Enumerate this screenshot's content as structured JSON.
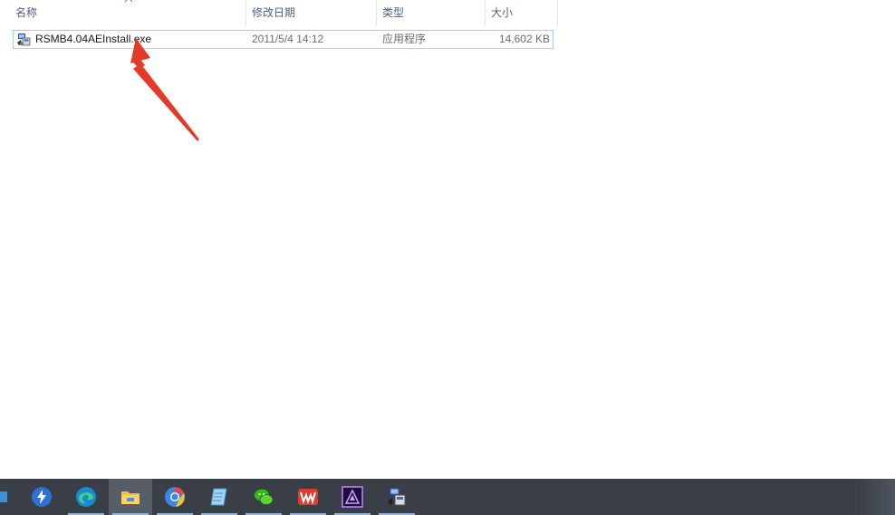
{
  "columns": {
    "name": "名称",
    "date_modified": "修改日期",
    "type": "类型",
    "size": "大小"
  },
  "file": {
    "name": "RSMB4.04AEInstall.exe",
    "date_modified": "2011/5/4 14:12",
    "type": "应用程序",
    "size": "14,602 KB",
    "icon": "installer-icon"
  },
  "colors": {
    "selection_border": "#99d1ff",
    "annotation_arrow": "#e53a2a",
    "taskbar": "#3a3f47"
  },
  "taskbar": {
    "items": [
      {
        "icon": "lightning-app-icon",
        "running": false
      },
      {
        "icon": "edge-icon",
        "running": true
      },
      {
        "icon": "file-explorer-icon",
        "running": true,
        "active": true
      },
      {
        "icon": "chrome-app-icon",
        "running": true
      },
      {
        "icon": "notepad-app-icon",
        "running": true
      },
      {
        "icon": "wechat-icon",
        "running": true
      },
      {
        "icon": "wps-icon",
        "running": true
      },
      {
        "icon": "after-effects-icon",
        "running": true
      },
      {
        "icon": "installer-icon",
        "running": true
      }
    ]
  }
}
